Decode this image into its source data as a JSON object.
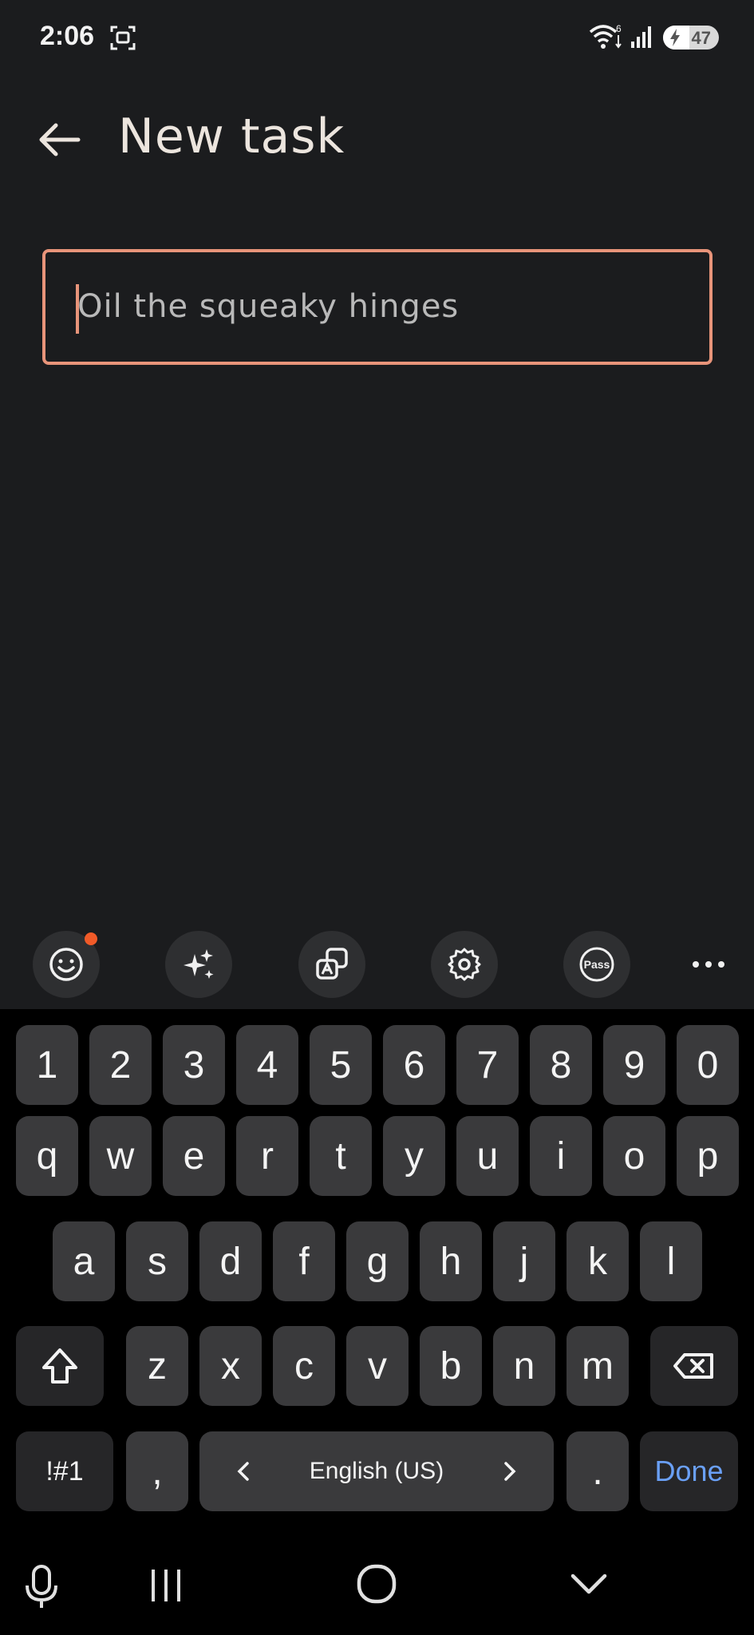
{
  "status_bar": {
    "time": "2:06",
    "battery_level": "47",
    "wifi_label": "6",
    "icons": [
      "screenshot-icon",
      "wifi-icon",
      "signal-icon",
      "battery-icon"
    ]
  },
  "header": {
    "title": "New task",
    "back_icon": "arrow-back-icon"
  },
  "task_input": {
    "value": "Oil the squeaky hinges",
    "accent_color": "#e8947a"
  },
  "keyboard_toolbar": {
    "items": [
      "emoji-icon",
      "ai-sparkle-icon",
      "translate-icon",
      "settings-icon",
      "pass-icon",
      "more-icon"
    ],
    "pass_label": "Pass"
  },
  "keyboard": {
    "number_row": [
      "1",
      "2",
      "3",
      "4",
      "5",
      "6",
      "7",
      "8",
      "9",
      "0"
    ],
    "row1": [
      "q",
      "w",
      "e",
      "r",
      "t",
      "y",
      "u",
      "i",
      "o",
      "p"
    ],
    "row2": [
      "a",
      "s",
      "d",
      "f",
      "g",
      "h",
      "j",
      "k",
      "l"
    ],
    "row3": [
      "z",
      "x",
      "c",
      "v",
      "b",
      "n",
      "m"
    ],
    "symbols_label": "!#1",
    "comma_label": ",",
    "space_label": "English (US)",
    "period_label": ".",
    "done_label": "Done",
    "done_color": "#6aa0f7"
  },
  "nav_bar": {
    "items": [
      "microphone-icon",
      "recent-apps-icon",
      "home-icon",
      "hide-keyboard-icon"
    ]
  }
}
